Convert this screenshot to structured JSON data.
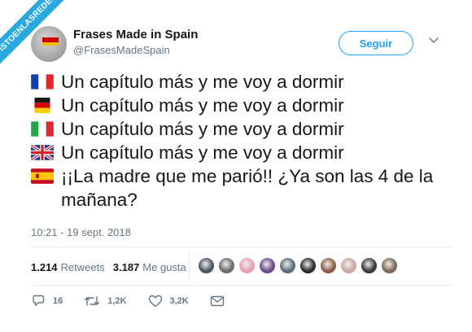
{
  "watermark": "VISTOENLASREDES",
  "user": {
    "name": "Frases Made in Spain",
    "handle": "@FrasesMadeSpain",
    "avatar_icon": "profile-avatar"
  },
  "follow_label": "Seguir",
  "menu_icon": "chevron-down-icon",
  "tweet": {
    "lines": [
      {
        "flag": "france",
        "text": "Un capítulo más y me voy a dormir"
      },
      {
        "flag": "germany",
        "text": "Un capítulo más y me voy a dormir"
      },
      {
        "flag": "italy",
        "text": "Un capítulo más y me voy a dormir"
      },
      {
        "flag": "united-kingdom",
        "text": "Un capítulo más y me voy a dormir"
      },
      {
        "flag": "spain",
        "text": "¡¡La madre que me parió!! ¿Ya son las 4 de la mañana?"
      }
    ]
  },
  "timestamp": "10:21 - 19 sept. 2018",
  "stats": {
    "retweets_count": "1.214",
    "retweets_label": "Retweets",
    "likes_count": "3.187",
    "likes_label": "Me gusta"
  },
  "likers": [
    {
      "color": "#4a5566"
    },
    {
      "color": "#6d6d6d"
    },
    {
      "color": "#e8a0b0"
    },
    {
      "color": "#6b4a8a"
    },
    {
      "color": "#5a6e7a"
    },
    {
      "color": "#2b2b2b"
    },
    {
      "color": "#8a6048"
    },
    {
      "color": "#c7a9a0"
    },
    {
      "color": "#3a3a3a"
    },
    {
      "color": "#7d6a5a"
    }
  ],
  "actions": {
    "replies": "16",
    "retweets": "1,2K",
    "likes": "3,2K"
  },
  "colors": {
    "accent": "#1da1f2",
    "text": "#14171a",
    "muted": "#657786",
    "divider": "#e6ecf0",
    "watermark_bg": "#2aa9e0"
  }
}
